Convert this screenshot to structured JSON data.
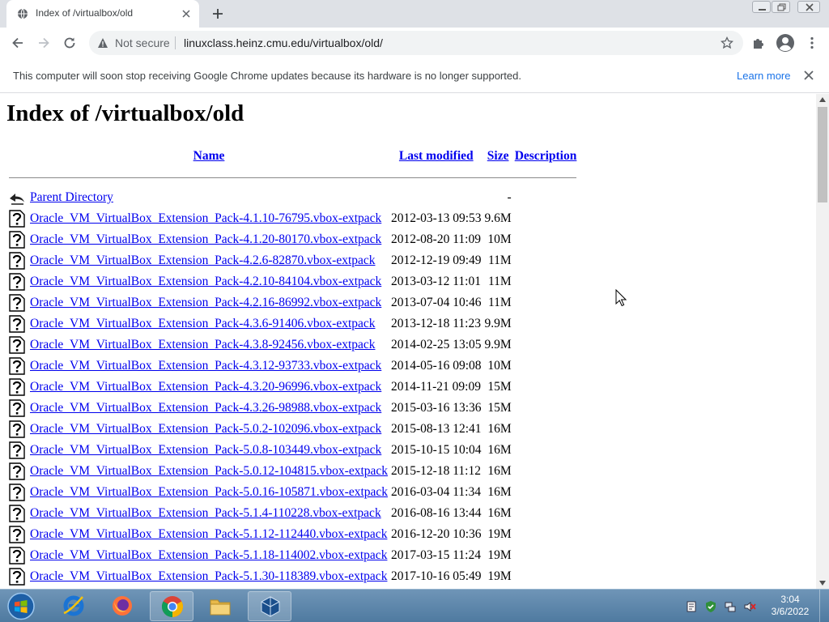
{
  "browser": {
    "tab": {
      "title": "Index of /virtualbox/old"
    },
    "omnibox": {
      "security_label": "Not secure",
      "url": "linuxclass.heinz.cmu.edu/virtualbox/old/"
    }
  },
  "infobar": {
    "message": "This computer will soon stop receiving Google Chrome updates because its hardware is no longer supported.",
    "learn_more": "Learn more"
  },
  "page": {
    "title": "Index of /virtualbox/old",
    "columns": [
      "Name",
      "Last modified",
      "Size",
      "Description"
    ],
    "parent": {
      "label": "Parent Directory",
      "size": "-"
    },
    "files": [
      {
        "name": "Oracle_VM_VirtualBox_Extension_Pack-4.1.10-76795.vbox-extpack",
        "modified": "2012-03-13 09:53",
        "size": "9.6M"
      },
      {
        "name": "Oracle_VM_VirtualBox_Extension_Pack-4.1.20-80170.vbox-extpack",
        "modified": "2012-08-20 11:09",
        "size": "10M"
      },
      {
        "name": "Oracle_VM_VirtualBox_Extension_Pack-4.2.6-82870.vbox-extpack",
        "modified": "2012-12-19 09:49",
        "size": "11M"
      },
      {
        "name": "Oracle_VM_VirtualBox_Extension_Pack-4.2.10-84104.vbox-extpack",
        "modified": "2013-03-12 11:01",
        "size": "11M"
      },
      {
        "name": "Oracle_VM_VirtualBox_Extension_Pack-4.2.16-86992.vbox-extpack",
        "modified": "2013-07-04 10:46",
        "size": "11M"
      },
      {
        "name": "Oracle_VM_VirtualBox_Extension_Pack-4.3.6-91406.vbox-extpack",
        "modified": "2013-12-18 11:23",
        "size": "9.9M"
      },
      {
        "name": "Oracle_VM_VirtualBox_Extension_Pack-4.3.8-92456.vbox-extpack",
        "modified": "2014-02-25 13:05",
        "size": "9.9M"
      },
      {
        "name": "Oracle_VM_VirtualBox_Extension_Pack-4.3.12-93733.vbox-extpack",
        "modified": "2014-05-16 09:08",
        "size": "10M"
      },
      {
        "name": "Oracle_VM_VirtualBox_Extension_Pack-4.3.20-96996.vbox-extpack",
        "modified": "2014-11-21 09:09",
        "size": "15M"
      },
      {
        "name": "Oracle_VM_VirtualBox_Extension_Pack-4.3.26-98988.vbox-extpack",
        "modified": "2015-03-16 13:36",
        "size": "15M"
      },
      {
        "name": "Oracle_VM_VirtualBox_Extension_Pack-5.0.2-102096.vbox-extpack",
        "modified": "2015-08-13 12:41",
        "size": "16M"
      },
      {
        "name": "Oracle_VM_VirtualBox_Extension_Pack-5.0.8-103449.vbox-extpack",
        "modified": "2015-10-15 10:04",
        "size": "16M"
      },
      {
        "name": "Oracle_VM_VirtualBox_Extension_Pack-5.0.12-104815.vbox-extpack",
        "modified": "2015-12-18 11:12",
        "size": "16M"
      },
      {
        "name": "Oracle_VM_VirtualBox_Extension_Pack-5.0.16-105871.vbox-extpack",
        "modified": "2016-03-04 11:34",
        "size": "16M"
      },
      {
        "name": "Oracle_VM_VirtualBox_Extension_Pack-5.1.4-110228.vbox-extpack",
        "modified": "2016-08-16 13:44",
        "size": "16M"
      },
      {
        "name": "Oracle_VM_VirtualBox_Extension_Pack-5.1.12-112440.vbox-extpack",
        "modified": "2016-12-20 10:36",
        "size": "19M"
      },
      {
        "name": "Oracle_VM_VirtualBox_Extension_Pack-5.1.18-114002.vbox-extpack",
        "modified": "2017-03-15 11:24",
        "size": "19M"
      },
      {
        "name": "Oracle_VM_VirtualBox_Extension_Pack-5.1.30-118389.vbox-extpack",
        "modified": "2017-10-16 05:49",
        "size": "19M"
      },
      {
        "name": "",
        "modified": "",
        "size": ""
      }
    ]
  },
  "taskbar": {
    "apps": [
      {
        "name": "internet-explorer-icon"
      },
      {
        "name": "firefox-icon"
      },
      {
        "name": "chrome-icon",
        "active": true
      },
      {
        "name": "file-explorer-icon"
      },
      {
        "name": "virtualbox-icon",
        "active": true
      }
    ],
    "clock": {
      "time": "3:04",
      "date": "3/6/2022"
    }
  },
  "colors": {
    "link": "#0000ee",
    "chrome_frame": "#dee1e6",
    "taskbar": "#5a84aa",
    "infobar_link": "#1a73e8"
  }
}
